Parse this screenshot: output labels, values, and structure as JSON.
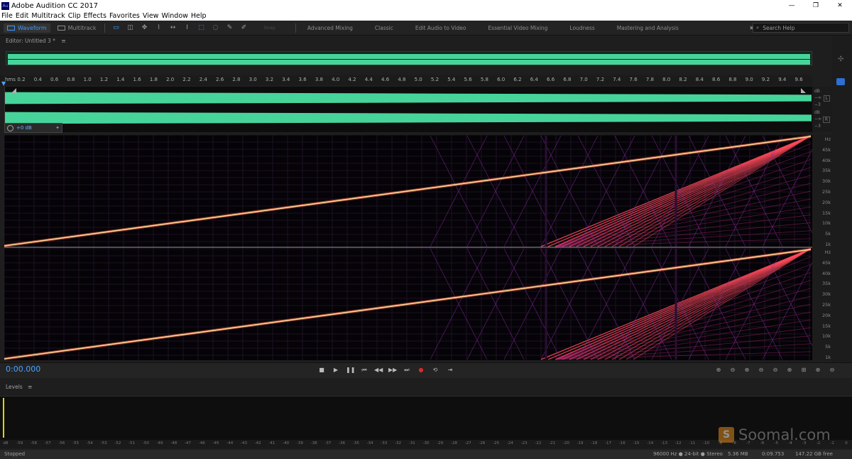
{
  "app": {
    "title": "Adobe Audition CC 2017",
    "icon_label": "Au"
  },
  "menu": [
    "File",
    "Edit",
    "Multitrack",
    "Clip",
    "Effects",
    "Favorites",
    "View",
    "Window",
    "Help"
  ],
  "toolbar": {
    "modes": [
      "Waveform",
      "Multitrack"
    ],
    "active_mode": "Waveform",
    "workspaces": [
      "Advanced Mixing",
      "Classic",
      "Edit Audio to Video",
      "Essential Video Mixing",
      "Loudness",
      "Mastering and Analysis"
    ],
    "search_placeholder": "Search Help",
    "overflow": "»",
    "snap_label": "Snap"
  },
  "editor": {
    "tab_label": "Editor: Untitled 3 *",
    "menu_glyph": "≡"
  },
  "ruler": {
    "unit": "hms",
    "ticks": [
      "0.2",
      "0.4",
      "0.6",
      "0.8",
      "1.0",
      "1.2",
      "1.4",
      "1.6",
      "1.8",
      "2.0",
      "2.2",
      "2.4",
      "2.6",
      "2.8",
      "3.0",
      "3.2",
      "3.4",
      "3.6",
      "3.8",
      "4.0",
      "4.2",
      "4.4",
      "4.6",
      "4.8",
      "5.0",
      "5.2",
      "5.4",
      "5.6",
      "5.8",
      "6.0",
      "6.2",
      "6.4",
      "6.6",
      "6.8",
      "7.0",
      "7.2",
      "7.4",
      "7.6",
      "7.8",
      "8.0",
      "8.2",
      "8.4",
      "8.6",
      "8.8",
      "9.0",
      "9.2",
      "9.4",
      "9.6"
    ]
  },
  "waveform": {
    "db_labels": [
      "dB",
      "−∞",
      "−3"
    ],
    "channels": [
      "L",
      "R"
    ]
  },
  "hud": {
    "volume": "+0 dB"
  },
  "spectral": {
    "hz_labels": [
      "Hz",
      "45k",
      "40k",
      "35k",
      "30k",
      "25k",
      "20k",
      "15k",
      "10k",
      "5k",
      "1k"
    ]
  },
  "transport": {
    "timecode": "0:00.000",
    "buttons": [
      "stop",
      "play",
      "pause",
      "go-to-start",
      "rewind",
      "fast-forward",
      "go-to-end",
      "record",
      "loop",
      "skip-selection"
    ]
  },
  "levels": {
    "tab_label": "Levels",
    "menu_glyph": "≡",
    "level_fill": 0.0,
    "scale": [
      "dB",
      "-59",
      "-58",
      "-57",
      "-56",
      "-55",
      "-54",
      "-53",
      "-52",
      "-51",
      "-50",
      "-49",
      "-48",
      "-47",
      "-46",
      "-45",
      "-44",
      "-43",
      "-42",
      "-41",
      "-40",
      "-39",
      "-38",
      "-37",
      "-36",
      "-35",
      "-34",
      "-33",
      "-32",
      "-31",
      "-30",
      "-29",
      "-28",
      "-27",
      "-26",
      "-25",
      "-24",
      "-23",
      "-22",
      "-21",
      "-20",
      "-19",
      "-18",
      "-17",
      "-16",
      "-15",
      "-14",
      "-13",
      "-12",
      "-11",
      "-10",
      "-9",
      "-8",
      "-7",
      "-6",
      "-5",
      "-4",
      "-3",
      "-2",
      "-1",
      "0"
    ]
  },
  "status": {
    "state": "Stopped",
    "format": "96000 Hz ● 24-bit ● Stereo",
    "size": "5.36 MB",
    "duration": "0:09.753",
    "free": "147.22 GB free"
  },
  "watermark": {
    "text": "Soomal.com",
    "logo": "S"
  },
  "colors": {
    "waveform": "#46d49a",
    "accent": "#3d9bff",
    "spectral_line": "#ff4a5a",
    "spectral_fundamental": "#ffd9a0",
    "spectral_grid": "#8a2aa8"
  }
}
